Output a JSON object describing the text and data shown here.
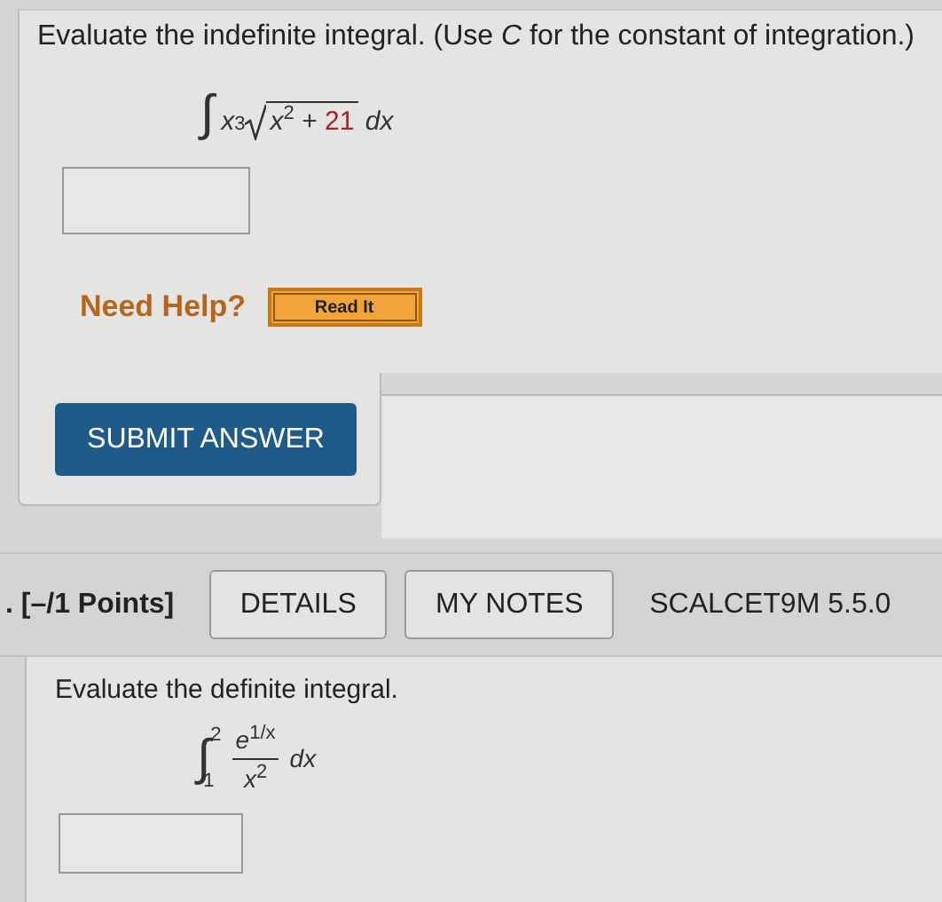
{
  "question_1": {
    "prompt": "Evaluate the indefinite integral. (Use ",
    "prompt_italic": "C",
    "prompt_end": " for the constant of integration.)",
    "integral": {
      "sign": "∫",
      "base": "x",
      "power": "3",
      "radicand_base": "x",
      "radicand_power": "2",
      "operator": "+",
      "constant": "21",
      "differential": "dx"
    },
    "help": {
      "label": "Need Help?",
      "button": "Read It"
    },
    "submit": "SUBMIT ANSWER"
  },
  "question_2": {
    "number": ".",
    "points": "[–/1 Points]",
    "buttons": [
      {
        "label": "DETAILS"
      },
      {
        "label": "MY NOTES"
      }
    ],
    "code": "SCALCET9M 5.5.0",
    "prompt": "Evaluate the definite integral.",
    "integral": {
      "sign": "∫",
      "upper": "2",
      "lower": "1",
      "numerator_base": "e",
      "numerator_power": "1/x",
      "denominator_base": "x",
      "denominator_power": "2",
      "differential": "dx"
    }
  }
}
